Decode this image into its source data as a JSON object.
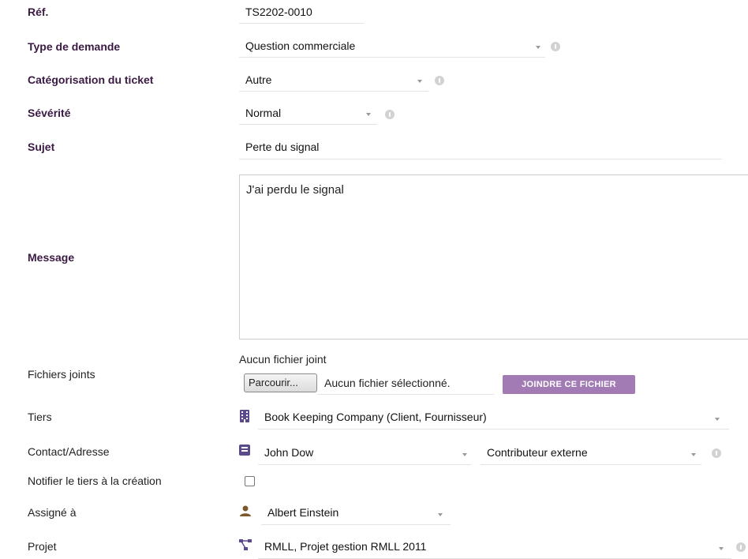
{
  "labels": {
    "ref": "Réf.",
    "type": "Type de demande",
    "category": "Catégorisation du ticket",
    "severity": "Sévérité",
    "subject": "Sujet",
    "message": "Message",
    "files": "Fichiers joints",
    "thirdparty": "Tiers",
    "contact": "Contact/Adresse",
    "notify": "Notifier le tiers à la création",
    "assigned": "Assigné à",
    "project": "Projet"
  },
  "values": {
    "ref": "TS2202-0010",
    "type": "Question commerciale",
    "category": "Autre",
    "severity": "Normal",
    "subject": "Perte du signal",
    "message": "J'ai perdu le signal",
    "files_none": "Aucun fichier joint",
    "browse": "Parcourir...",
    "no_file": "Aucun fichier sélectionné.",
    "attach": "JOINDRE CE FICHIER",
    "thirdparty": "Book Keeping Company (Client, Fournisseur)",
    "contact": "John Dow",
    "contact_role": "Contributeur externe",
    "assigned": "Albert Einstein",
    "project": "RMLL, Projet gestion RMLL 2011"
  },
  "colors": {
    "required_label": "#3a1a43",
    "accent_button": "#a27bb4",
    "icon_purple": "#5b4a8b",
    "icon_brown": "#7a5a2c"
  },
  "icons": {
    "thirdparty": "building-icon",
    "contact": "contact-card-icon",
    "assigned": "user-icon",
    "project": "project-tree-icon"
  }
}
